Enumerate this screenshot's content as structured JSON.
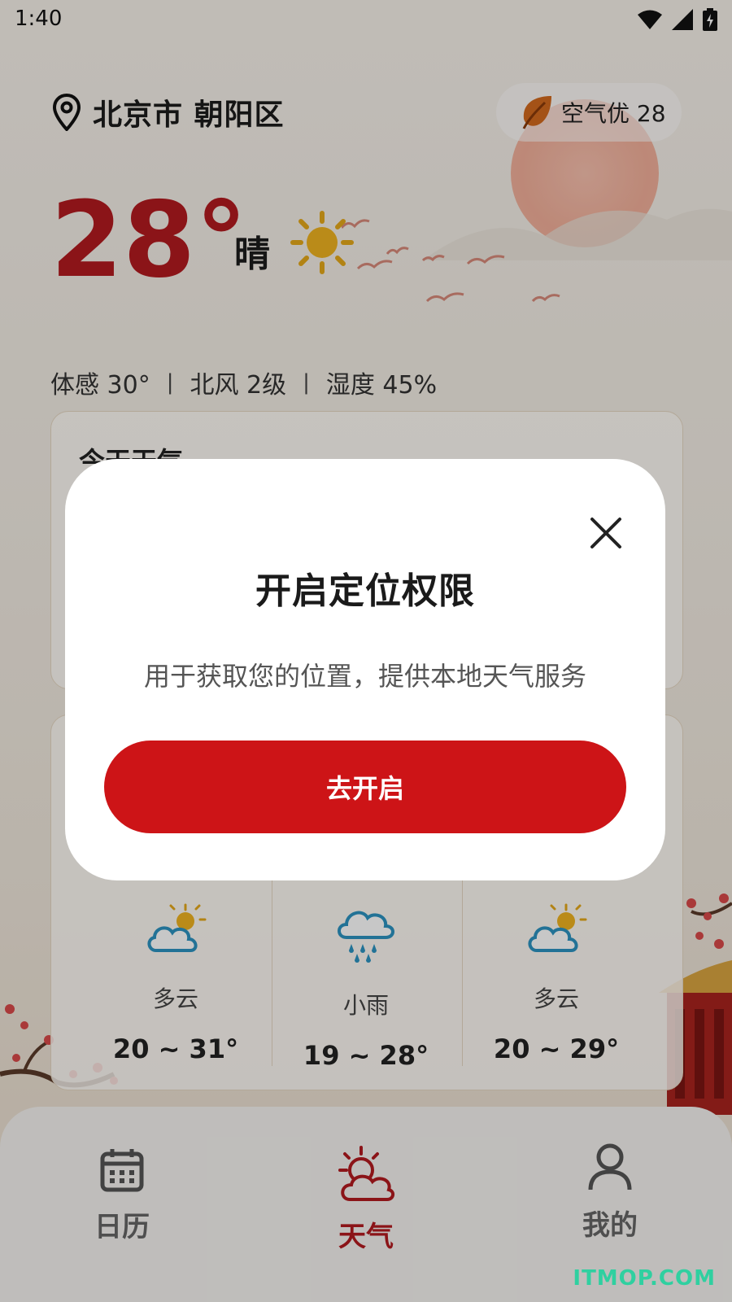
{
  "status_bar": {
    "time": "1:40",
    "icons": [
      "wifi-icon",
      "signal-icon",
      "battery-charging-icon"
    ]
  },
  "header": {
    "location": "北京市 朝阳区",
    "air_quality": {
      "label": "空气优 28",
      "icon": "leaf-icon",
      "color": "#d2691e"
    }
  },
  "current": {
    "temperature": "28°",
    "condition": "晴",
    "condition_icon": "sun-icon",
    "details": [
      "体感 30°",
      "北风 2级",
      "湿度 45%"
    ],
    "details_separator": "|"
  },
  "today_card": {
    "title": "今天天气"
  },
  "forecast": [
    {
      "icon": "partly-cloudy-icon",
      "desc": "多云",
      "range": "20 ~ 31°"
    },
    {
      "icon": "rain-icon",
      "desc": "小雨",
      "range": "19 ~ 28°"
    },
    {
      "icon": "partly-cloudy-icon",
      "desc": "多云",
      "range": "20 ~ 29°"
    }
  ],
  "bottom_nav": [
    {
      "label": "日历",
      "icon": "calendar-icon",
      "active": false
    },
    {
      "label": "天气",
      "icon": "weather-icon",
      "active": true
    },
    {
      "label": "我的",
      "icon": "user-icon",
      "active": false
    }
  ],
  "dialog": {
    "title": "开启定位权限",
    "message": "用于获取您的位置，提供本地天气服务",
    "button": "去开启",
    "close_icon": "close-icon"
  },
  "watermark": "ITMOP.COM",
  "colors": {
    "accent": "#b31a1f",
    "button": "#cd1417",
    "watermark": "#2fd0a0"
  }
}
